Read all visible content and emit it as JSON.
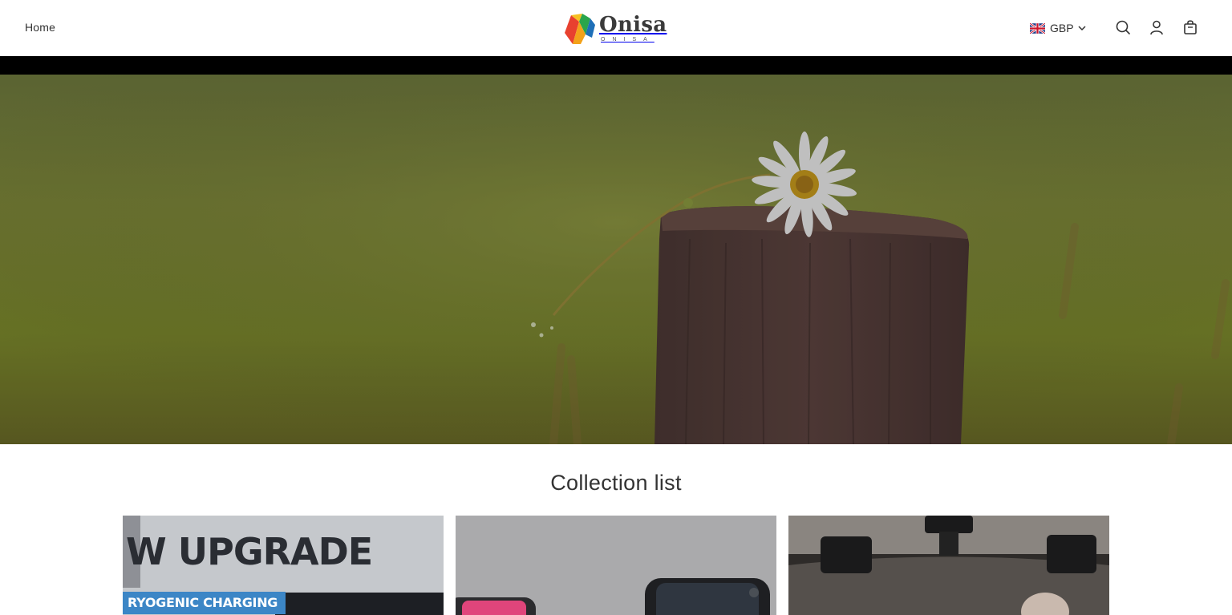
{
  "header": {
    "nav_home": "Home",
    "logo_word": "Onisa",
    "logo_sub": "ONISA",
    "currency_code": "GBP"
  },
  "icons": {
    "search": "search-icon",
    "account": "account-icon",
    "cart": "cart-icon",
    "chevron": "chevron-down-icon",
    "flag": "uk-flag-icon"
  },
  "hero": {
    "image_alt": "Daisy resting on a wooden post in a green field"
  },
  "collection": {
    "title": "Collection list",
    "cards": [
      {
        "headline": "W UPGRADE",
        "badge": "RYOGENIC CHARGING"
      },
      {
        "headline": "",
        "badge": ""
      },
      {
        "headline": "",
        "badge": ""
      }
    ]
  },
  "colors": {
    "announce_bar": "#000000",
    "badge_blue": "#3c86c6",
    "text": "#333333"
  }
}
